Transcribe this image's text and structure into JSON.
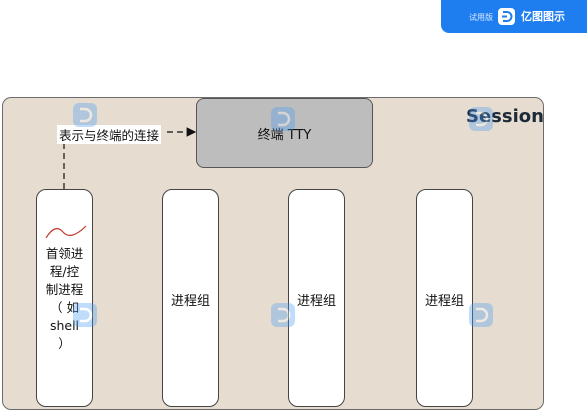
{
  "watermark": {
    "trial_text": "试用版",
    "brand_text": "亿图图示",
    "repeat_text": "亿图图示",
    "badge_color": "#1e7ef0"
  },
  "diagram": {
    "session_label": "Session",
    "terminal_label": "终端 TTY",
    "connection_label": "表示与终端的连接",
    "session_leader": {
      "lines": [
        "首领进",
        "程/控",
        "制进程",
        "（ 如",
        "shell",
        "）"
      ]
    },
    "process_groups": [
      "进程组",
      "进程组",
      "进程组"
    ],
    "colors": {
      "session_fill": "#e6ddd0",
      "terminal_fill": "#bdbdbd",
      "box_fill": "#ffffff",
      "squiggle": "#c0392b"
    }
  }
}
